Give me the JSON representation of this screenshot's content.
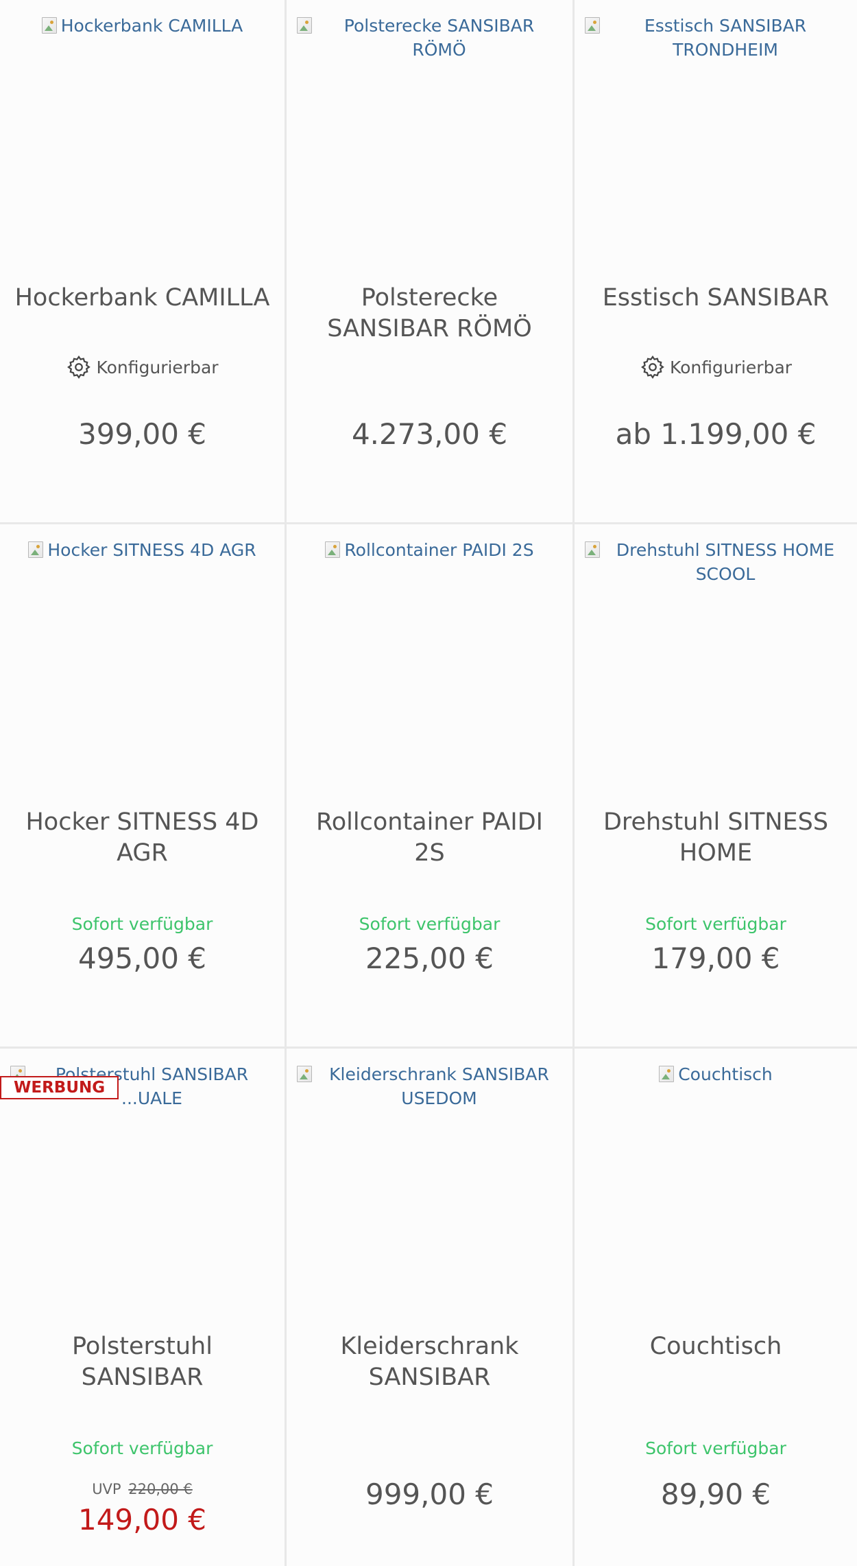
{
  "products": [
    {
      "alt": "Hockerbank CAMILLA",
      "name": "Hockerbank CAMILLA",
      "config": "Konfigurierbar",
      "price": "399,00 €"
    },
    {
      "alt": "Polsterecke SANSIBAR RÖMÖ",
      "name": "Polsterecke SANSIBAR RÖMÖ",
      "price": "4.273,00 €"
    },
    {
      "alt": "Esstisch SANSIBAR TRONDHEIM",
      "name": "Esstisch SANSIBAR",
      "config": "Konfigurierbar",
      "price": "ab 1.199,00 €"
    },
    {
      "alt": "Hocker SITNESS 4D AGR",
      "name": "Hocker SITNESS 4D AGR",
      "availability": "Sofort verfügbar",
      "price": "495,00 €"
    },
    {
      "alt": "Rollcontainer PAIDI 2S",
      "name": "Rollcontainer PAIDI 2S",
      "availability": "Sofort verfügbar",
      "price": "225,00 €"
    },
    {
      "alt": "Drehstuhl SITNESS HOME SCOOL",
      "name": "Drehstuhl SITNESS HOME",
      "availability": "Sofort verfügbar",
      "price": "179,00 €"
    },
    {
      "alt": "Polsterstuhl SANSIBAR ...UALE",
      "badge": "WERBUNG",
      "name": "Polsterstuhl SANSIBAR",
      "availability": "Sofort verfügbar",
      "uvp_label": "UVP",
      "uvp_old": "220,00 €",
      "price": "149,00 €"
    },
    {
      "alt": "Kleiderschrank SANSIBAR USEDOM",
      "name": "Kleiderschrank SANSIBAR",
      "price": "999,00 €"
    },
    {
      "alt": "Couchtisch",
      "name": "Couchtisch",
      "availability": "Sofort verfügbar",
      "price": "89,90 €"
    }
  ]
}
